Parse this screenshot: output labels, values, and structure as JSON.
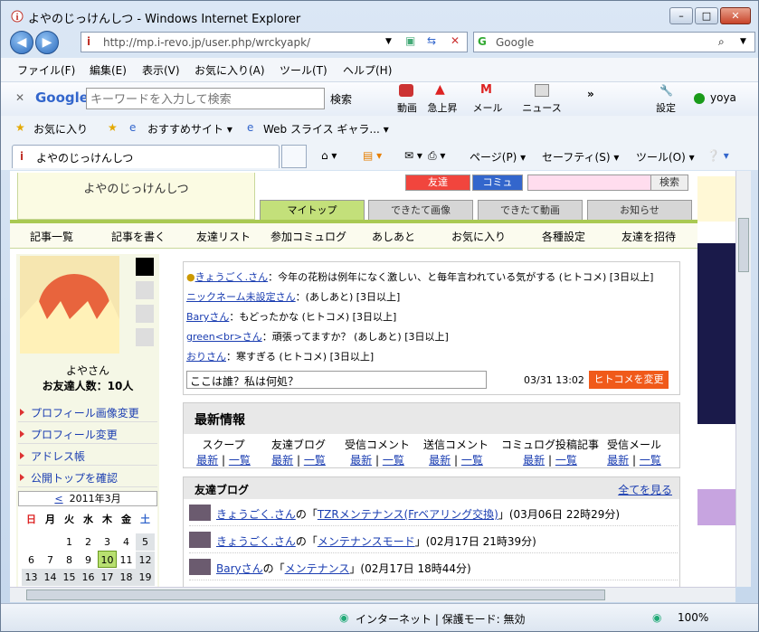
{
  "window": {
    "title": "よやのじっけんしつ - Windows Internet Explorer",
    "min": "–",
    "max": "□",
    "close": "✕"
  },
  "address": {
    "url": "http://mp.i-revo.jp/user.php/wrckyapk/",
    "search_label": "Google"
  },
  "menu": [
    "ファイル(F)",
    "編集(E)",
    "表示(V)",
    "お気に入り(A)",
    "ツール(T)",
    "ヘルプ(H)"
  ],
  "google_toolbar": {
    "logo": "Google",
    "placeholder": "キーワードを入力して検索",
    "search_btn": "検索",
    "items": [
      "動画",
      "急上昇",
      "メール",
      "ニュース",
      "設定"
    ],
    "more": "»",
    "user": "yoya"
  },
  "favorites": {
    "fav_label": "お気に入り",
    "suggested": "おすすめサイト ▾",
    "webslice": "Web スライス ギャラ... ▾"
  },
  "tab": {
    "title": "よやのじっけんしつ"
  },
  "commands": [
    "ページ(P) ▾",
    "セーフティ(S) ▾",
    "ツール(O) ▾"
  ],
  "site": {
    "name": "よやのじっけんしつ",
    "top_buttons": [
      "友達",
      "コミュ"
    ],
    "search_btn": "検索",
    "tabs": [
      "マイトップ",
      "できたて画像",
      "できたて動画",
      "お知らせ"
    ],
    "nav": [
      "記事一覧",
      "記事を書く",
      "友達リスト",
      "参加コミュログ",
      "あしあと",
      "お気に入り",
      "各種設定",
      "友達を招待"
    ]
  },
  "profile": {
    "name": "よやさん",
    "friends": "お友達人数：10人",
    "links": [
      "プロフィール画像変更",
      "プロフィール変更",
      "アドレス帳",
      "公開トップを確認"
    ]
  },
  "calendar": {
    "month": "2011年3月",
    "prev": "<",
    "weekdays": [
      "日",
      "月",
      "火",
      "水",
      "木",
      "金",
      "土"
    ],
    "rows": [
      [
        "",
        "",
        "1",
        "2",
        "3",
        "4",
        "5"
      ],
      [
        "6",
        "7",
        "8",
        "9",
        "10",
        "11",
        "12"
      ],
      [
        "13",
        "14",
        "15",
        "16",
        "17",
        "18",
        "19"
      ]
    ],
    "today": "10"
  },
  "hitokome": {
    "lines": [
      {
        "user": "きょうごく.さん",
        "text": "：今年の花粉は例年になく激しい、と毎年言われている気がする (ヒトコメ) [3日以上]"
      },
      {
        "user": "ニックネーム未設定さん",
        "text": "：(あしあと) [3日以上]"
      },
      {
        "user": "Baryさん",
        "text": "：もどったかな (ヒトコメ) [3日以上]"
      },
      {
        "user": "green<br>さん",
        "text": "：頑張ってますか？ (あしあと) [3日以上]"
      },
      {
        "user": "おりさん",
        "text": "：寒すぎる (ヒトコメ) [3日以上]"
      }
    ],
    "input_value": "ここは誰？私は何処？",
    "timestamp": "03/31 13:02",
    "change_btn": "ヒトコメを変更"
  },
  "latest": {
    "title": "最新情報",
    "columns": [
      "スクープ",
      "友達ブログ",
      "受信コメント",
      "送信コメント",
      "コミュログ投稿記事",
      "受信メール"
    ],
    "latest_label": "最新",
    "list_label": "一覧",
    "sep": "|"
  },
  "friend_blog": {
    "title": "友達ブログ",
    "all_link": "全てを見る",
    "entries": [
      {
        "user": "きょうごく.さん",
        "pre": "の「",
        "title": "TZRメンテナンス(Frベアリング交換)",
        "post": "」(03月06日 22時29分)"
      },
      {
        "user": "きょうごく.さん",
        "pre": "の「",
        "title": "メンテナンスモード",
        "post": "」(02月17日 21時39分)"
      },
      {
        "user": "Baryさん",
        "pre": "の「",
        "title": "メンテナンス",
        "post": "」(02月17日 18時44分)"
      }
    ]
  },
  "status": {
    "zone": "インターネット | 保護モード: 無効",
    "zoom": "100%"
  },
  "colors": {
    "accent": "#a9c952",
    "orange": "#f05a1a",
    "link": "#1a3db1"
  }
}
